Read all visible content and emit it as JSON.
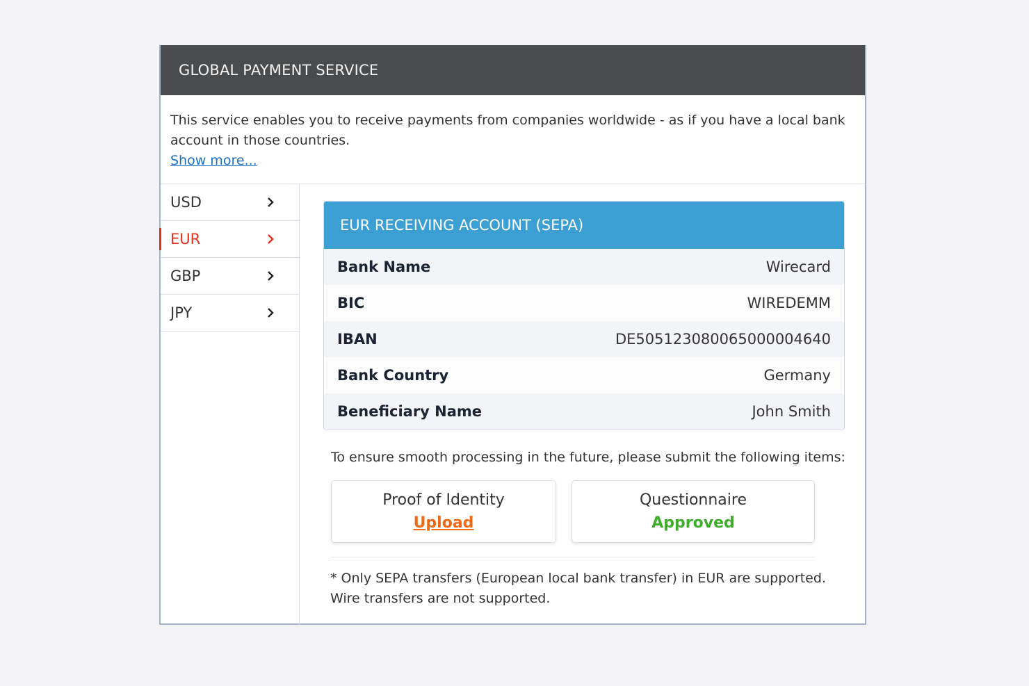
{
  "header": {
    "title": "GLOBAL PAYMENT SERVICE"
  },
  "intro": {
    "text": "This service enables you to receive payments from companies worldwide - as if you have a local bank account in those countries.",
    "link": "Show more..."
  },
  "sidebar": {
    "items": [
      {
        "label": "USD",
        "active": false
      },
      {
        "label": "EUR",
        "active": true
      },
      {
        "label": "GBP",
        "active": false
      },
      {
        "label": "JPY",
        "active": false
      }
    ]
  },
  "account": {
    "title": "EUR RECEIVING ACCOUNT (SEPA)",
    "rows": [
      {
        "label": "Bank Name",
        "value": "Wirecard"
      },
      {
        "label": "BIC",
        "value": "WIREDEMM"
      },
      {
        "label": "IBAN",
        "value": "DE50512308006500000464​0"
      },
      {
        "label": "Bank Country",
        "value": "Germany"
      },
      {
        "label": "Beneficiary Name",
        "value": "John Smith"
      }
    ]
  },
  "submit": {
    "notice": "To ensure smooth processing in the future, please submit the following items:",
    "items": [
      {
        "title": "Proof of Identity",
        "status": "Upload"
      },
      {
        "title": "Questionnaire",
        "status": "Approved"
      }
    ]
  },
  "footnote": {
    "line1": "* Only SEPA transfers (European local bank transfer) in EUR are supported.",
    "line2": "Wire transfers are not supported."
  },
  "colors": {
    "header_bg": "#4a4b4d",
    "account_header": "#3c9fd4",
    "active": "#e0321c",
    "upload": "#ee6a16",
    "approved": "#3fae2a",
    "link": "#1e6fc2"
  }
}
